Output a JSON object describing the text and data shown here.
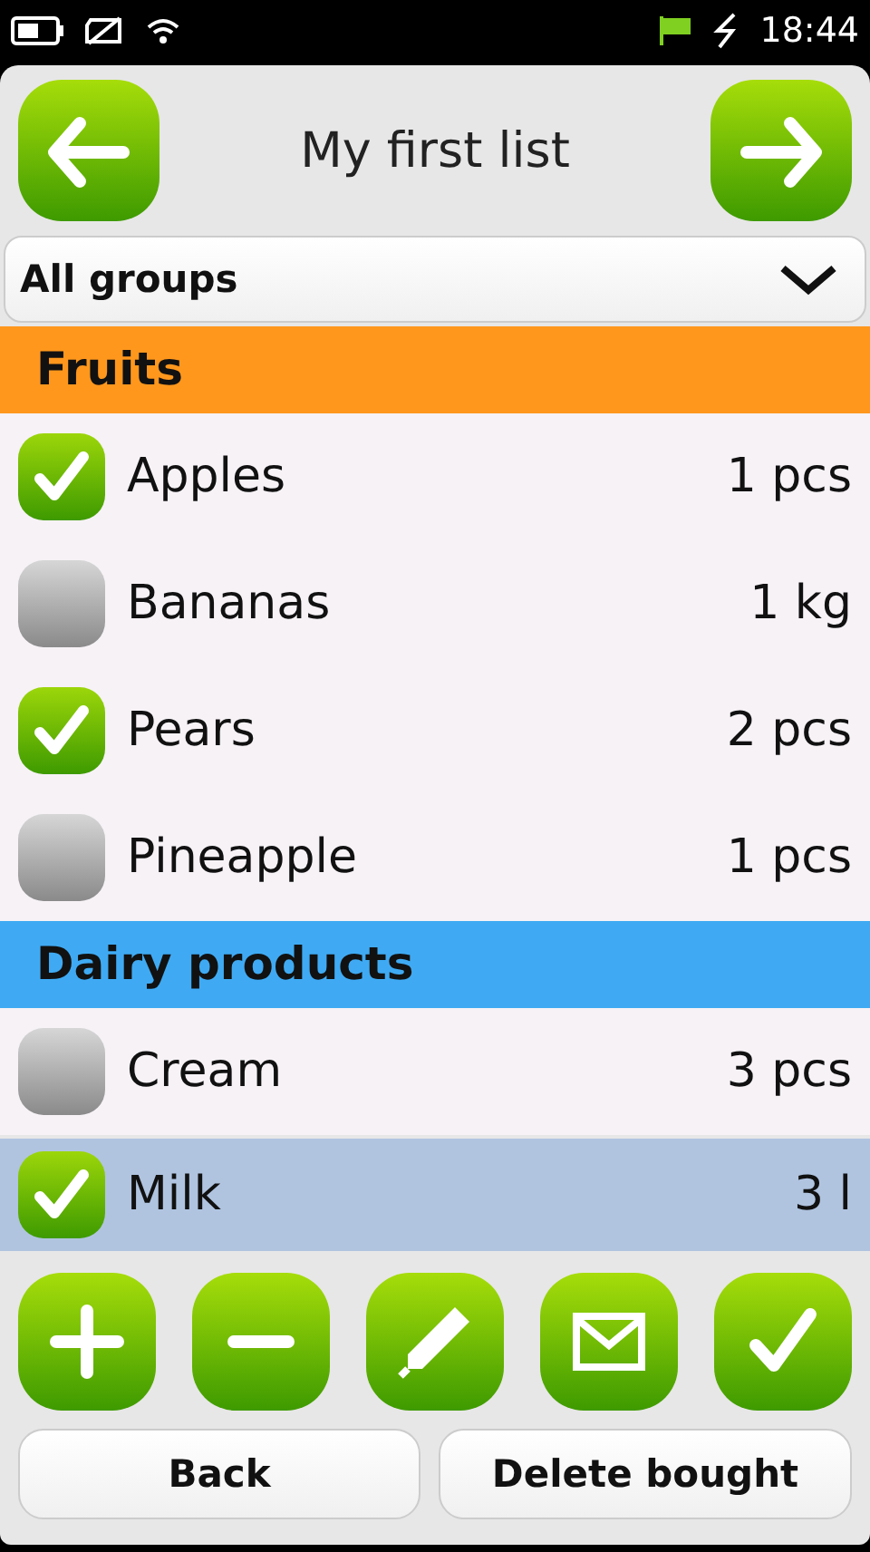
{
  "status_bar": {
    "time": "18:44"
  },
  "header": {
    "title": "My first list"
  },
  "group_filter": {
    "value": "All groups"
  },
  "groups": [
    {
      "name": "Fruits",
      "color": "#ff971d",
      "items": [
        {
          "name": "Apples",
          "amount": "1 pcs",
          "checked": true,
          "selected": false
        },
        {
          "name": "Bananas",
          "amount": "1 kg",
          "checked": false,
          "selected": false
        },
        {
          "name": "Pears",
          "amount": "2 pcs",
          "checked": true,
          "selected": false
        },
        {
          "name": "Pineapple",
          "amount": "1 pcs",
          "checked": false,
          "selected": false
        }
      ]
    },
    {
      "name": "Dairy products",
      "color": "#3faaf3",
      "items": [
        {
          "name": "Cream",
          "amount": "3 pcs",
          "checked": false,
          "selected": false
        },
        {
          "name": "Milk",
          "amount": "3 l",
          "checked": true,
          "selected": true
        }
      ]
    }
  ],
  "toolbar": [
    {
      "kind": "add"
    },
    {
      "kind": "remove"
    },
    {
      "kind": "edit"
    },
    {
      "kind": "mail"
    },
    {
      "kind": "done"
    }
  ],
  "buttons": [
    "Back",
    "Delete bought"
  ]
}
